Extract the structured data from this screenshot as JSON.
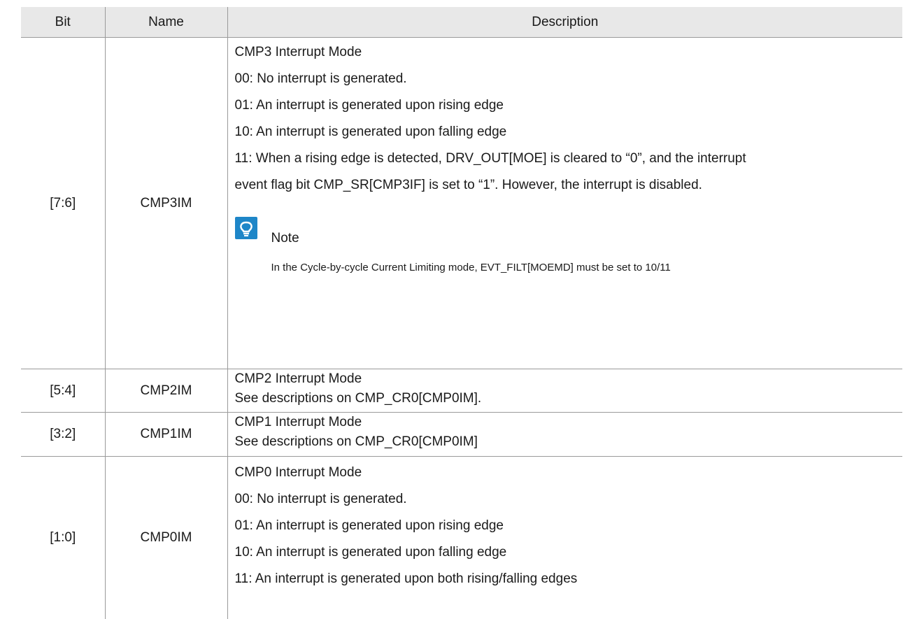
{
  "table": {
    "headers": {
      "bit": "Bit",
      "name": "Name",
      "description": "Description"
    },
    "rows": [
      {
        "bit": "[7:6]",
        "name": "CMP3IM",
        "lines": [
          "CMP3 Interrupt Mode",
          "00: No interrupt is generated.",
          "01: An interrupt is generated upon rising edge",
          "10: An interrupt is generated upon falling edge",
          "11: When a rising edge is detected, DRV_OUT[MOE] is cleared to “0”, and the interrupt",
          "event flag bit CMP_SR[CMP3IF] is set to “1”. However, the interrupt is disabled."
        ],
        "note": {
          "icon": "lightbulb-icon",
          "title": "Note",
          "text": "In the Cycle-by-cycle Current Limiting mode, EVT_FILT[MOEMD] must be set to 10/11"
        }
      },
      {
        "bit": "[5:4]",
        "name": "CMP2IM",
        "lines": [
          "CMP2 Interrupt Mode",
          "See descriptions on CMP_CR0[CMP0IM]."
        ]
      },
      {
        "bit": "[3:2]",
        "name": "CMP1IM",
        "lines": [
          "CMP1 Interrupt Mode",
          "See descriptions on CMP_CR0[CMP0IM]"
        ]
      },
      {
        "bit": "[1:0]",
        "name": "CMP0IM",
        "lines": [
          "CMP0 Interrupt Mode",
          "00: No interrupt is generated.",
          "01: An interrupt is generated upon rising edge",
          "10: An interrupt is generated upon falling edge",
          "11: An interrupt is generated upon both rising/falling edges"
        ]
      }
    ]
  },
  "colors": {
    "header_bg": "#e8e8e8",
    "note_icon": "#1e86c8",
    "rule": "#9a9a9a"
  }
}
